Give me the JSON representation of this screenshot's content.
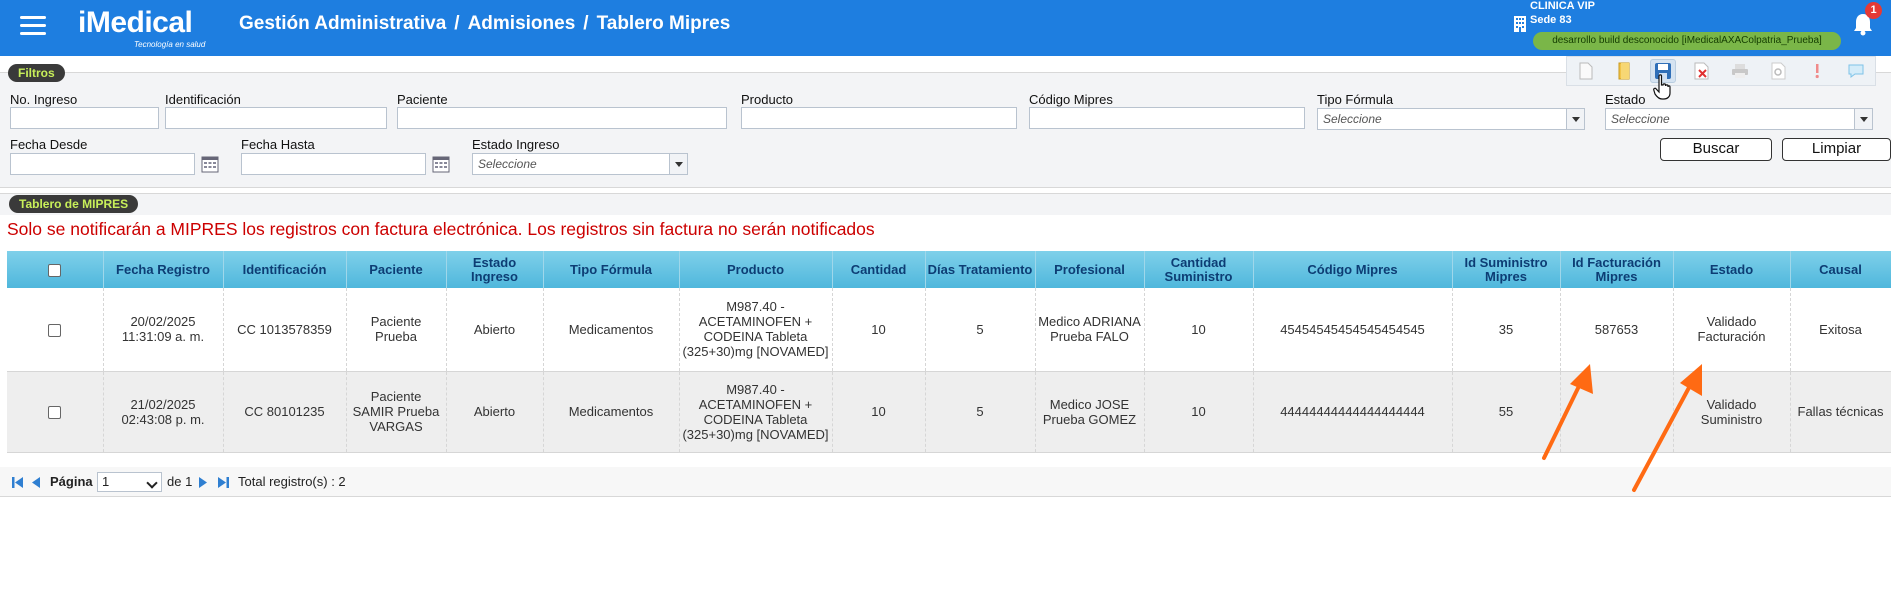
{
  "header": {
    "logo_text": "iMedical",
    "logo_tagline": "Tecnología en salud",
    "breadcrumb": [
      "Gestión Administrativa",
      "Admisiones",
      "Tablero Mipres"
    ],
    "breadcrumb_sep": "/",
    "clinic": "CLINICA VIP",
    "sede": "Sede 83",
    "build_info": "desarrollo build desconocido [iMedicalAXAColpatria_Prueba]",
    "notifications_count": "1",
    "header_color": "#1e7ee0"
  },
  "toolbar": {
    "icons": [
      "new-doc-icon",
      "folder-icon",
      "save-icon",
      "cancel-icon",
      "print-icon",
      "preview-icon",
      "alert-icon",
      "comment-icon"
    ]
  },
  "filtros": {
    "panel_title": "Filtros",
    "labels": {
      "no_ingreso": "No. Ingreso",
      "identificacion": "Identificación",
      "paciente": "Paciente",
      "producto": "Producto",
      "codigo_mipres": "Código Mipres",
      "tipo_formula": "Tipo Fórmula",
      "estado": "Estado",
      "fecha_desde": "Fecha Desde",
      "fecha_hasta": "Fecha Hasta",
      "estado_ingreso": "Estado Ingreso"
    },
    "select_placeholder": "Seleccione",
    "buttons": {
      "buscar": "Buscar",
      "limpiar": "Limpiar"
    }
  },
  "tablero": {
    "panel_title": "Tablero de MIPRES",
    "notice": "Solo se notificarán a MIPRES los registros con factura electrónica. Los registros sin factura no serán notificados",
    "columns": [
      "",
      "Fecha Registro",
      "Identificación",
      "Paciente",
      "Estado Ingreso",
      "Tipo Fórmula",
      "Producto",
      "Cantidad",
      "Días Tratamiento",
      "Profesional",
      "Cantidad Suministro",
      "Código Mipres",
      "Id Suministro Mipres",
      "Id Facturación Mipres",
      "Estado",
      "Causal"
    ],
    "rows": [
      {
        "fecha": "20/02/2025 11:31:09 a. m.",
        "identificacion": "CC 1013578359",
        "paciente": "Paciente Prueba",
        "estado_ingreso": "Abierto",
        "tipo_formula": "Medicamentos",
        "producto": "M987.40 - ACETAMINOFEN + CODEINA Tableta (325+30)mg [NOVAMED]",
        "cantidad": "10",
        "dias": "5",
        "profesional": "Medico ADRIANA Prueba FALO",
        "cant_suministro": "10",
        "codigo_mipres": "45454545454545454545",
        "id_suministro": "35",
        "id_facturacion": "587653",
        "estado": "Validado Facturación",
        "causal": "Exitosa"
      },
      {
        "fecha": "21/02/2025 02:43:08 p. m.",
        "identificacion": "CC 80101235",
        "paciente": "Paciente SAMIR Prueba VARGAS",
        "estado_ingreso": "Abierto",
        "tipo_formula": "Medicamentos",
        "producto": "M987.40 - ACETAMINOFEN + CODEINA Tableta (325+30)mg [NOVAMED]",
        "cantidad": "10",
        "dias": "5",
        "profesional": "Medico JOSE Prueba GOMEZ",
        "cant_suministro": "10",
        "codigo_mipres": "44444444444444444444",
        "id_suministro": "55",
        "id_facturacion": "",
        "estado": "Validado Suministro",
        "causal": "Fallas técnicas"
      }
    ]
  },
  "pager": {
    "page_label": "Página",
    "page_value": "1",
    "of_label": "de 1",
    "total": "Total registro(s) : 2"
  }
}
